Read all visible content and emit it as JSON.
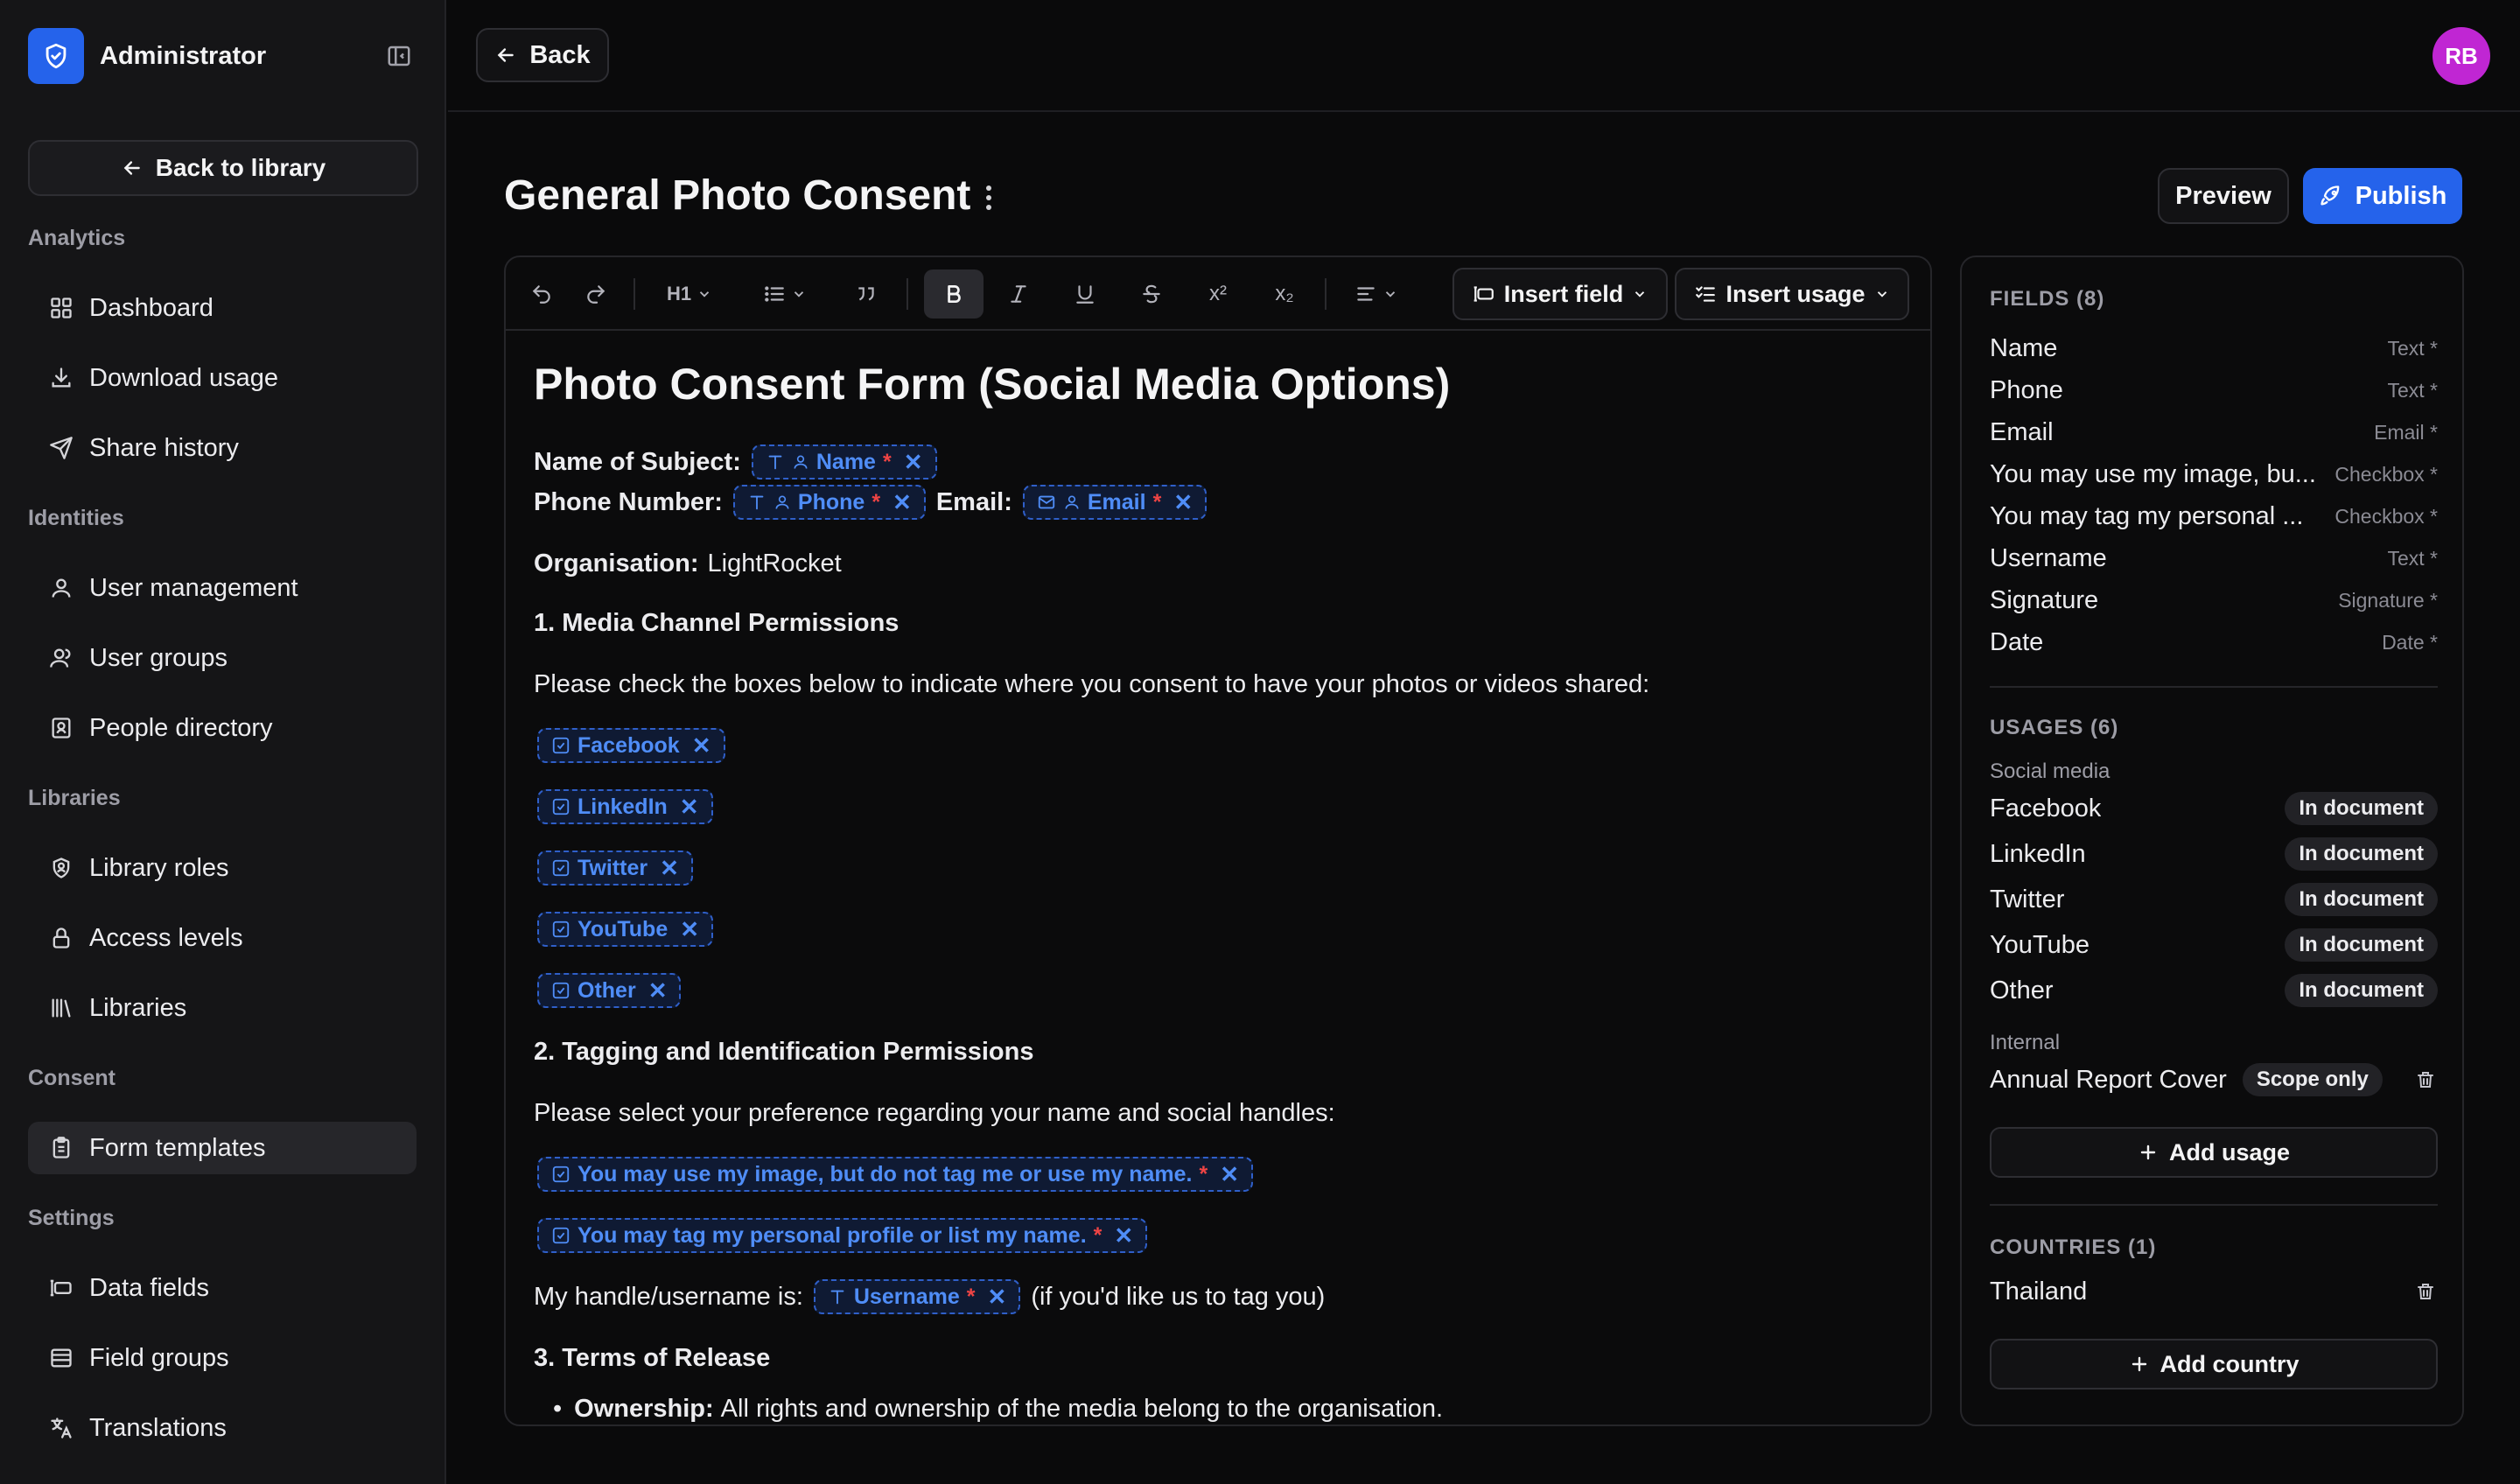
{
  "sidebar": {
    "brand": "Administrator",
    "back_to_library": "Back to library",
    "sections": {
      "analytics": "Analytics",
      "identities": "Identities",
      "libraries": "Libraries",
      "consent": "Consent",
      "settings": "Settings"
    },
    "items": {
      "dashboard": "Dashboard",
      "download_usage": "Download usage",
      "share_history": "Share history",
      "user_management": "User management",
      "user_groups": "User groups",
      "people_directory": "People directory",
      "library_roles": "Library roles",
      "access_levels": "Access levels",
      "libraries": "Libraries",
      "form_templates": "Form templates",
      "data_fields": "Data fields",
      "field_groups": "Field groups",
      "translations": "Translations"
    },
    "active_item": "form_templates"
  },
  "topbar": {
    "back_label": "Back",
    "avatar_initials": "RB",
    "avatar_color": "#c026d3"
  },
  "header": {
    "title": "General Photo Consent",
    "preview_label": "Preview",
    "publish_label": "Publish"
  },
  "toolbar": {
    "heading_label": "H1",
    "superscript": "x²",
    "subscript": "x₂",
    "insert_field": "Insert field",
    "insert_usage": "Insert usage"
  },
  "document": {
    "title": "Photo Consent Form (Social Media Options)",
    "name_of_subject_label": "Name of Subject:",
    "phone_label": "Phone Number:",
    "email_label": "Email:",
    "chip_name": "Name",
    "chip_phone": "Phone",
    "chip_email": "Email",
    "required_mark": "*",
    "organisation_label": "Organisation:",
    "organisation_value": "LightRocket",
    "section1": "1. Media Channel Permissions",
    "section1_text": "Please check the boxes below to indicate where you consent to have your photos or videos shared:",
    "channels": [
      "Facebook",
      "LinkedIn",
      "Twitter",
      "YouTube",
      "Other"
    ],
    "section2": "2. Tagging and Identification Permissions",
    "section2_text": "Please select your preference regarding your name and social handles:",
    "tag_option1": "You may use my image, but do not tag me or use my name.",
    "tag_option2": "You may tag my personal profile or list my name.",
    "handle_prefix": "My handle/username is:",
    "chip_username": "Username",
    "handle_suffix": "(if you'd like us to tag you)",
    "section3": "3. Terms of Release",
    "ownership_label": "Ownership:",
    "ownership_text": "All rights and ownership of the media belong to the organisation."
  },
  "panel": {
    "fields_header": "FIELDS (8)",
    "fields": [
      {
        "name": "Name",
        "type": "Text *"
      },
      {
        "name": "Phone",
        "type": "Text *"
      },
      {
        "name": "Email",
        "type": "Email *"
      },
      {
        "name": "You may use my image, bu...",
        "type": "Checkbox *"
      },
      {
        "name": "You may tag my personal ...",
        "type": "Checkbox *"
      },
      {
        "name": "Username",
        "type": "Text *"
      },
      {
        "name": "Signature",
        "type": "Signature *"
      },
      {
        "name": "Date",
        "type": "Date *"
      }
    ],
    "usages_header": "USAGES (6)",
    "social_media_label": "Social media",
    "usages": [
      {
        "name": "Facebook",
        "badge": "In document"
      },
      {
        "name": "LinkedIn",
        "badge": "In document"
      },
      {
        "name": "Twitter",
        "badge": "In document"
      },
      {
        "name": "YouTube",
        "badge": "In document"
      },
      {
        "name": "Other",
        "badge": "In document"
      }
    ],
    "internal_label": "Internal",
    "internal_usage": {
      "name": "Annual Report Cover",
      "badge": "Scope only"
    },
    "add_usage": "Add usage",
    "countries_header": "COUNTRIES (1)",
    "countries": [
      "Thailand"
    ],
    "add_country": "Add country"
  },
  "colors": {
    "accent": "#2563eb",
    "chip_text": "#4f8df7",
    "required": "#ef4444",
    "background": "#0a0a0b"
  }
}
